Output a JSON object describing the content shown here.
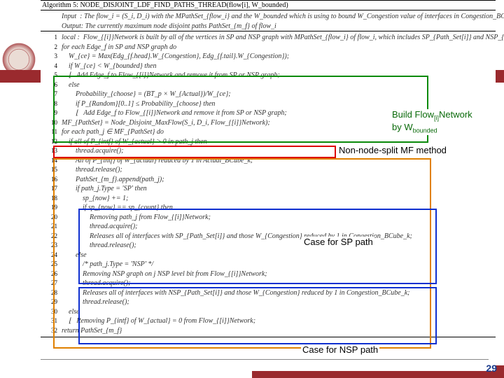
{
  "algorithm": {
    "title": "Algorithm 5: NODE_DISJOINT_LDF_FIND_PATHS_THREAD(flow[i], W_bounded)",
    "input": "Input  : The flow_i = (S_i, D_i) with the MPathSet_{flow_i} and the W_bounded which is using to bound W_Congestion value of interfaces in Congestion_BCube_k",
    "output": "Output: The currently maximum node disjoint paths PathSet_{m_f} of flow_i"
  },
  "lines": [
    {
      "n": "1",
      "t": "local :  Flow_{[i]}Network is built by all of the vertices in SP and NSP graph with MPathSet_{flow_i} of flow_i, which includes SP_{Path_Set[i]} and NSP_{Path_Set[i]};"
    },
    {
      "n": "2",
      "t": "for each Edge_f in SP and NSP graph do"
    },
    {
      "n": "3",
      "t": "    W_{ce} = Max(Edg_{f.head}.W_{Congestion}, Edg_{f.tail}.W_{Congestion});"
    },
    {
      "n": "4",
      "t": "    if W_{ce} < W_{bounded} then"
    },
    {
      "n": "5",
      "t": "    ⌊   Add Edge_f to Flow_{[i]}Network and remove it from SP or NSP graph;"
    },
    {
      "n": "6",
      "t": "    else"
    },
    {
      "n": "7",
      "t": "        Probability_{choose} = (BT_p × W_{Actual})/W_{ce};"
    },
    {
      "n": "8",
      "t": "        if P_{Random}[0..1] ≤ Probability_{choose} then"
    },
    {
      "n": "9",
      "t": "        ⌊   Add Edge_f to Flow_{[i]}Network and remove it from SP or NSP graph;"
    },
    {
      "n": "",
      "t": ""
    },
    {
      "n": "10",
      "t": "MF_{PathSet} = Node_Disjoint_MaxFlow(S_i, D_i, Flow_{[i]}Network);"
    },
    {
      "n": "11",
      "t": "for each path_j ∈ MF_{PathSet} do"
    },
    {
      "n": "12",
      "t": "    if all of P_{intf} of W_{actual} > 0 in path_j then"
    },
    {
      "n": "13",
      "t": "        thread.acquire();"
    },
    {
      "n": "14",
      "t": "        All of P_{intf} of W_{actual} reduced by 1 in Actual_BCube_k;"
    },
    {
      "n": "15",
      "t": "        thread.release();"
    },
    {
      "n": "16",
      "t": "        PathSet_{m_f}.append(path_j);"
    },
    {
      "n": "17",
      "t": "        if path_j.Type = 'SP' then"
    },
    {
      "n": "18",
      "t": "            sp_{now} += 1;"
    },
    {
      "n": "19",
      "t": "            if sp_{now} == sp_{count} then"
    },
    {
      "n": "20",
      "t": "                Removing path_j from Flow_{[i]}Network;"
    },
    {
      "n": "21",
      "t": "                thread.acquire();"
    },
    {
      "n": "22",
      "t": "                Releases all of interfaces with SP_{Path_Set[i]} and those W_{Congestion} reduced by 1 in Congestion_BCube_k;"
    },
    {
      "n": "23",
      "t": "                thread.release();"
    },
    {
      "n": "",
      "t": ""
    },
    {
      "n": "24",
      "t": "        else"
    },
    {
      "n": "25",
      "t": "            /* path_j.Type = 'NSP' */"
    },
    {
      "n": "26",
      "t": "            Removing NSP graph on j NSP level bit from Flow_{[i]}Network;"
    },
    {
      "n": "27",
      "t": "            thread.acquire();"
    },
    {
      "n": "28",
      "t": "            Releases all of interfaces with NSP_{Path_Set[i]} and those W_{Congestion} reduced by 1 in Congestion_BCube_k;"
    },
    {
      "n": "29",
      "t": "            thread.release();"
    },
    {
      "n": "",
      "t": ""
    },
    {
      "n": "30",
      "t": "    else"
    },
    {
      "n": "31",
      "t": "    ⌊   Removing P_{intf} of W_{actual} = 0 from Flow_{[i]}Network;"
    },
    {
      "n": "",
      "t": ""
    },
    {
      "n": "32",
      "t": "return PathSet_{m_f}"
    }
  ],
  "annotations": {
    "build": {
      "l1": "Build Flow",
      "l1sub": "[i]",
      "l1b": "Network",
      "l2": "by W",
      "l2sub": "bounded"
    },
    "mf": "Non-node-split MF method",
    "sp": "Case for SP path",
    "nsp": "Case for NSP path"
  },
  "page": "29"
}
